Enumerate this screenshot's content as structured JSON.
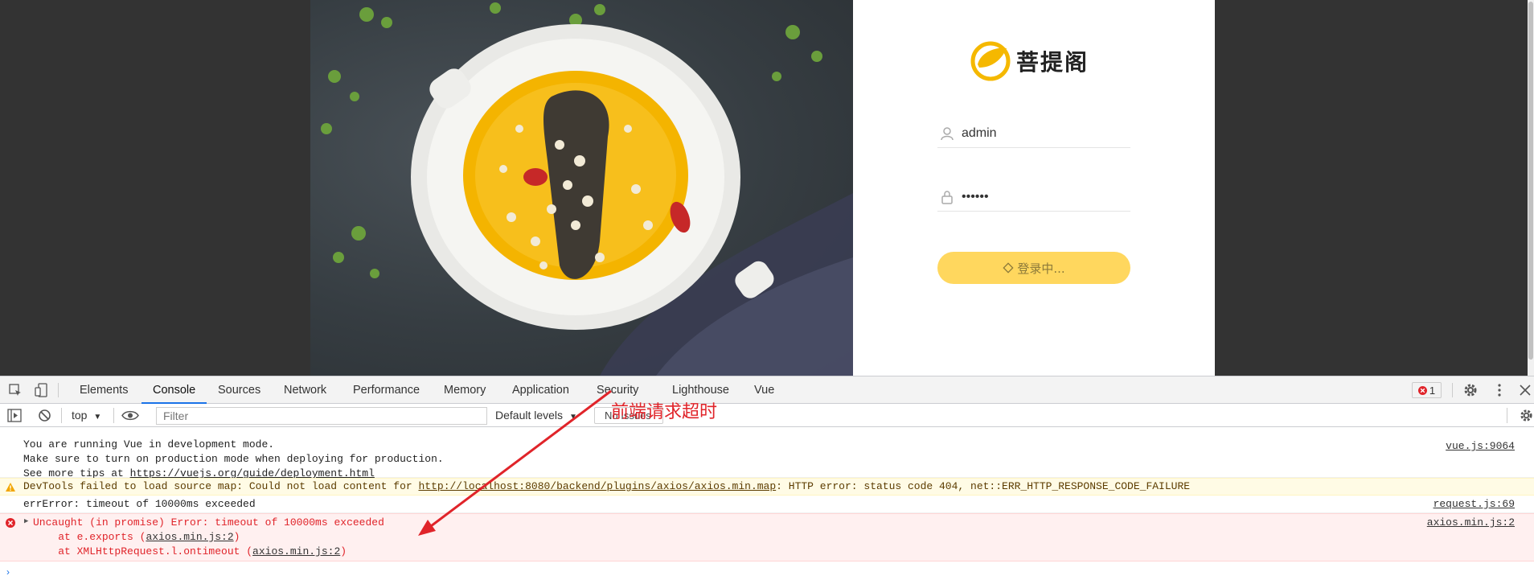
{
  "login": {
    "brand_name": "菩提阁",
    "username_value": "admin",
    "password_value": "••••••",
    "login_button_label": "登录中..."
  },
  "devtools": {
    "tabs": [
      "Elements",
      "Console",
      "Sources",
      "Network",
      "Performance",
      "Memory",
      "Application",
      "Security",
      "Lighthouse",
      "Vue"
    ],
    "active_tab": "Console",
    "error_count": "1",
    "context": "top",
    "filter_placeholder": "Filter",
    "levels": "Default levels",
    "issues": "No Issues"
  },
  "console": {
    "vue_msg": {
      "line1": "You are running Vue in development mode.",
      "line2": "Make sure to turn on production mode when deploying for production.",
      "line3_prefix": "See more tips at ",
      "line3_link": "https://vuejs.org/guide/deployment.html",
      "source": "vue.js:9064"
    },
    "warning_msg": {
      "prefix": "DevTools failed to load source map: Could not load content for ",
      "link": "http://localhost:8080/backend/plugins/axios/axios.min.map",
      "suffix": ": HTTP error: status code 404, net::ERR_HTTP_RESPONSE_CODE_FAILURE"
    },
    "log_msg": {
      "text": "errError: timeout of 10000ms exceeded",
      "source": "request.js:69"
    },
    "error_msg": {
      "line1": "Uncaught (in promise) Error: timeout of 10000ms exceeded",
      "line2_prefix": "    at e.exports (",
      "line2_link": "axios.min.js:2",
      "line2_suffix": ")",
      "line3_prefix": "    at XMLHttpRequest.l.ontimeout (",
      "line3_link": "axios.min.js:2",
      "line3_suffix": ")",
      "source": "axios.min.js:2"
    }
  },
  "annotation": "前端请求超时",
  "colors": {
    "accent": "#1a73e8",
    "error": "#e0242a",
    "button": "#ffd75e",
    "warning_bg": "#fffbe5",
    "error_bg": "#fff0f0"
  }
}
